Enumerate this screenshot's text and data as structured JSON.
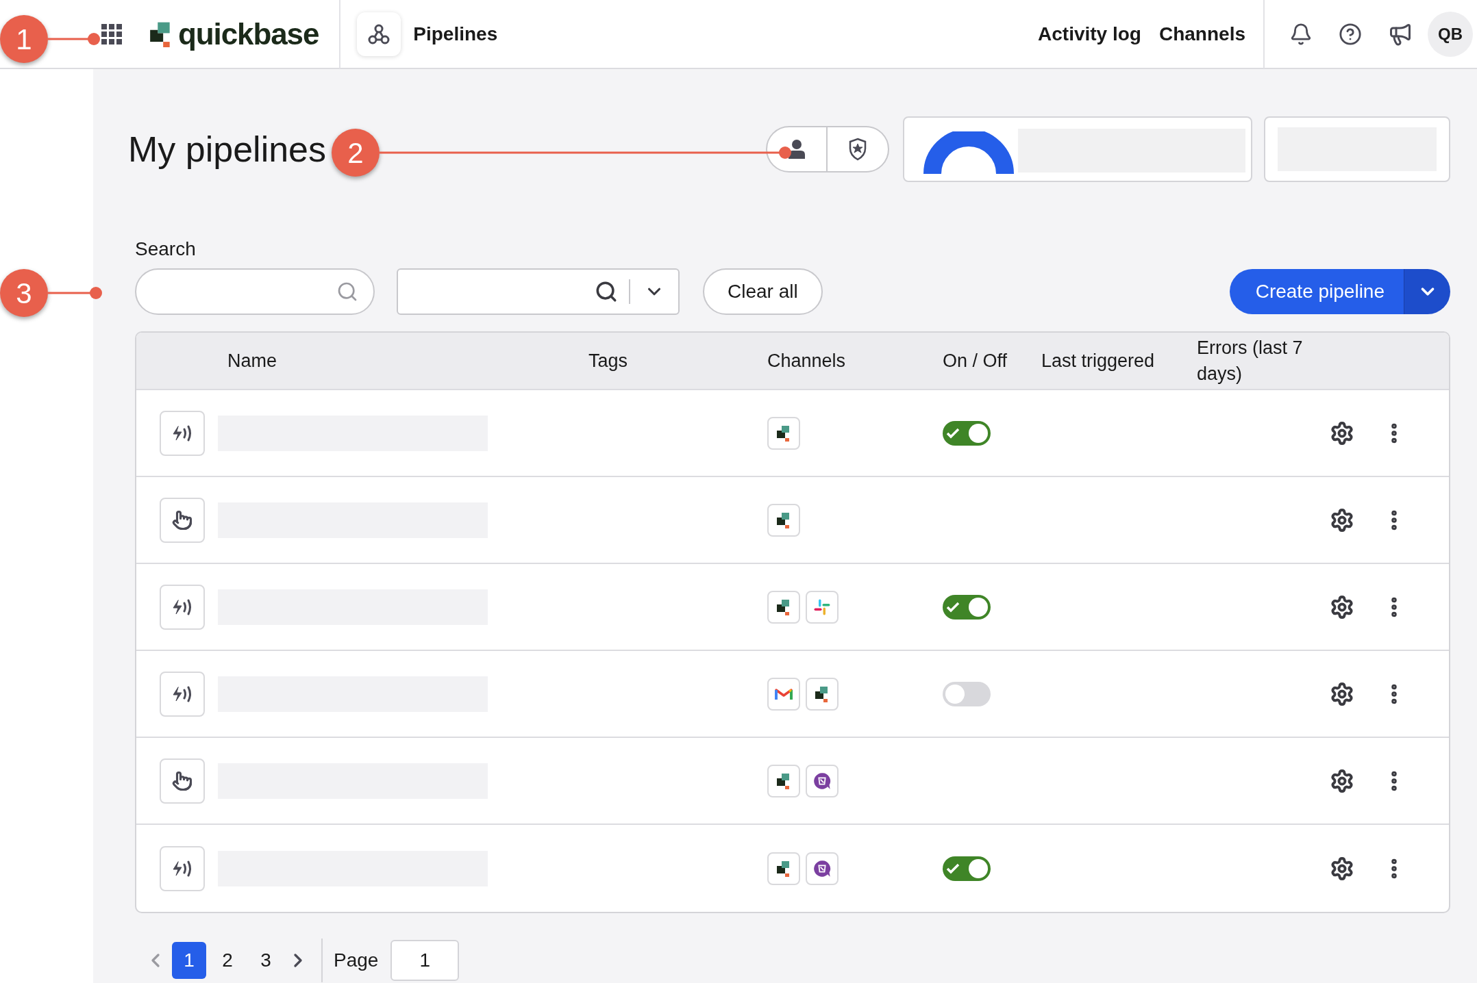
{
  "nav": {
    "logo": "quickbase",
    "app_title": "Pipelines",
    "links": [
      "Activity log",
      "Channels"
    ],
    "avatar": "QB"
  },
  "annotations": [
    {
      "label": "1"
    },
    {
      "label": "2"
    },
    {
      "label": "3"
    }
  ],
  "page_title": "My pipelines",
  "search": {
    "label": "Search"
  },
  "clear_button": "Clear all",
  "create_button": "Create pipeline",
  "table": {
    "columns": [
      "Name",
      "Tags",
      "Channels",
      "On / Off",
      "Last triggered",
      "Errors (last 7 days)"
    ],
    "rows": [
      {
        "trigger": {
          "kind": "event"
        },
        "channels": [
          {
            "kind": "quickbase"
          }
        ],
        "switch": {
          "on": true
        }
      },
      {
        "trigger": {
          "kind": "manual"
        },
        "channels": [
          {
            "kind": "quickbase"
          }
        ]
      },
      {
        "trigger": {
          "kind": "event"
        },
        "channels": [
          {
            "kind": "quickbase"
          },
          {
            "kind": "slack"
          }
        ],
        "switch": {
          "on": true
        }
      },
      {
        "trigger": {
          "kind": "event"
        },
        "channels": [
          {
            "kind": "gmail"
          },
          {
            "kind": "quickbase"
          }
        ],
        "switch": {
          "on": false
        }
      },
      {
        "trigger": {
          "kind": "manual"
        },
        "channels": [
          {
            "kind": "quickbase"
          },
          {
            "kind": "chat"
          }
        ]
      },
      {
        "trigger": {
          "kind": "event"
        },
        "channels": [
          {
            "kind": "quickbase"
          },
          {
            "kind": "chat"
          }
        ],
        "switch": {
          "on": true
        }
      }
    ]
  },
  "pagination": {
    "pages": [
      {
        "label": "1",
        "selected": true
      },
      {
        "label": "2",
        "selected": false
      },
      {
        "label": "3",
        "selected": false
      }
    ],
    "page_label": "Page",
    "page_value": "1"
  }
}
